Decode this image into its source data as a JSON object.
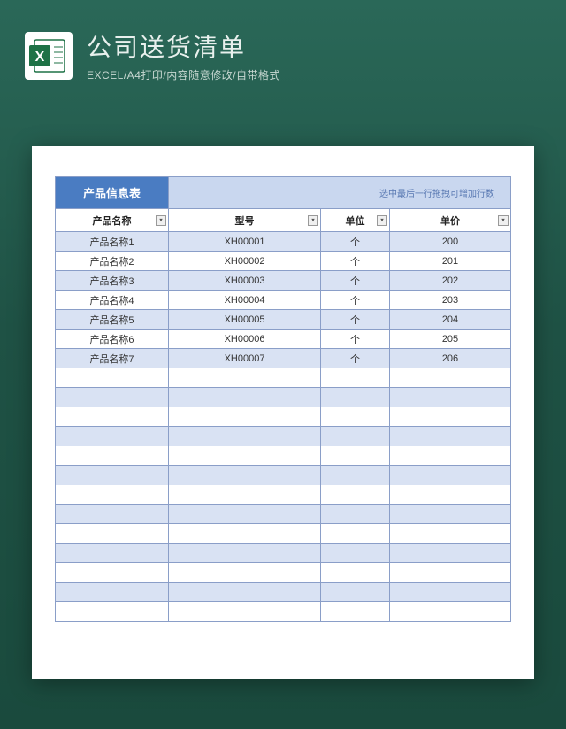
{
  "header": {
    "title": "公司送货清单",
    "subtitle": "EXCEL/A4打印/内容随意修改/自带格式"
  },
  "sheet": {
    "section_title": "产品信息表",
    "hint": "选中最后一行拖拽可增加行数",
    "columns": {
      "name": "产品名称",
      "model": "型号",
      "unit": "单位",
      "price": "单价"
    },
    "rows": [
      {
        "name": "产品名称1",
        "model": "XH00001",
        "unit": "个",
        "price": "200"
      },
      {
        "name": "产品名称2",
        "model": "XH00002",
        "unit": "个",
        "price": "201"
      },
      {
        "name": "产品名称3",
        "model": "XH00003",
        "unit": "个",
        "price": "202"
      },
      {
        "name": "产品名称4",
        "model": "XH00004",
        "unit": "个",
        "price": "203"
      },
      {
        "name": "产品名称5",
        "model": "XH00005",
        "unit": "个",
        "price": "204"
      },
      {
        "name": "产品名称6",
        "model": "XH00006",
        "unit": "个",
        "price": "205"
      },
      {
        "name": "产品名称7",
        "model": "XH00007",
        "unit": "个",
        "price": "206"
      }
    ],
    "empty_rows": 13
  }
}
